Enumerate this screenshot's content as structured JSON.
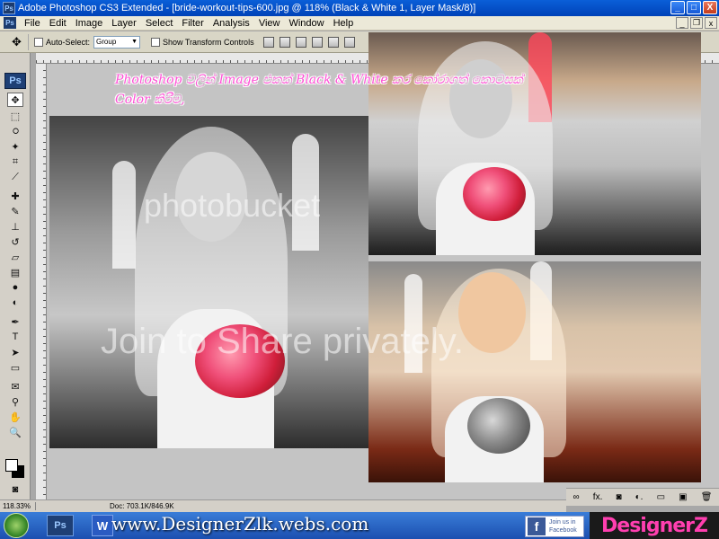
{
  "window": {
    "app_icon": "Ps",
    "title": "Adobe Photoshop CS3 Extended - [bride-workout-tips-600.jpg @ 118% (Black & White 1, Layer Mask/8)]",
    "minimize": "_",
    "maximize": "□",
    "close": "X"
  },
  "menu": {
    "items": [
      "File",
      "Edit",
      "Image",
      "Layer",
      "Select",
      "Filter",
      "Analysis",
      "View",
      "Window",
      "Help"
    ],
    "doc_minimize": "_",
    "doc_restore": "❐",
    "doc_close": "x"
  },
  "options": {
    "move_icon": "✥",
    "auto_select_label": "Auto-Select:",
    "auto_select_value": "Group",
    "show_transform_label": "Show Transform Controls"
  },
  "tools": {
    "ps_badge": "Ps",
    "icons": [
      "move-tool",
      "marquee-tool",
      "lasso-tool",
      "magic-wand-tool",
      "crop-tool",
      "slice-tool",
      "healing-brush-tool",
      "brush-tool",
      "clone-stamp-tool",
      "history-brush-tool",
      "eraser-tool",
      "gradient-tool",
      "blur-tool",
      "dodge-tool",
      "pen-tool",
      "type-tool",
      "path-selection-tool",
      "shape-tool",
      "notes-tool",
      "eyedropper-tool",
      "hand-tool",
      "zoom-tool"
    ]
  },
  "canvas": {
    "caption": "Photoshop වලින් Image එකක් Black & White කර කෝරාගත් කොටසක් Color කිරීම,",
    "watermark_top": "photobucket",
    "watermark_bottom": "Join to Share privately."
  },
  "status": {
    "zoom": "118.33%",
    "doc": "Doc: 703.1K/846.9K"
  },
  "layers_panel": {
    "buttons": [
      "link",
      "fx",
      "mask",
      "adjustment",
      "group",
      "new-layer",
      "delete"
    ]
  },
  "taskbar": {
    "ps_label": "Ps",
    "word_label": "W",
    "site": "www.DesignerZlk.webs.com",
    "facebook_line1": "Join us in",
    "facebook_line2": "Facebook",
    "brand": "DesignerZ"
  }
}
